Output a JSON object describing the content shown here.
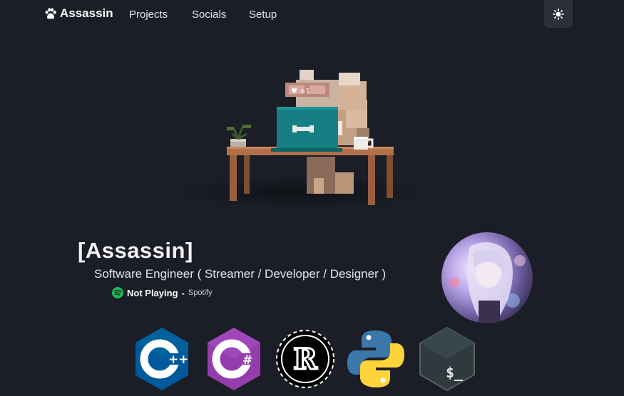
{
  "nav": {
    "brand": "Assassin",
    "links": [
      {
        "label": "Projects"
      },
      {
        "label": "Socials"
      },
      {
        "label": "Setup"
      }
    ],
    "theme_icon": "sun-icon"
  },
  "profile": {
    "name": "[Assassin]",
    "tagline": "Software Engineer ( Streamer / Developer / Designer )",
    "status": "Not Playing",
    "status_separator": "-",
    "status_source": "Spotify",
    "status_icon": "spotify-icon"
  },
  "languages": [
    {
      "icon": "cpp-icon",
      "badge": "++"
    },
    {
      "icon": "csharp-icon",
      "badge": "#"
    },
    {
      "icon": "rust-icon",
      "badge": "R"
    },
    {
      "icon": "python-icon"
    },
    {
      "icon": "bash-icon",
      "badge": "$_"
    }
  ],
  "colors": {
    "background": "#1b1e27",
    "theme_button": "#2c303a",
    "spotify": "#1db954",
    "cpp": "#00599c",
    "csharp": "#953dac",
    "bash": "#2f3a3f"
  }
}
